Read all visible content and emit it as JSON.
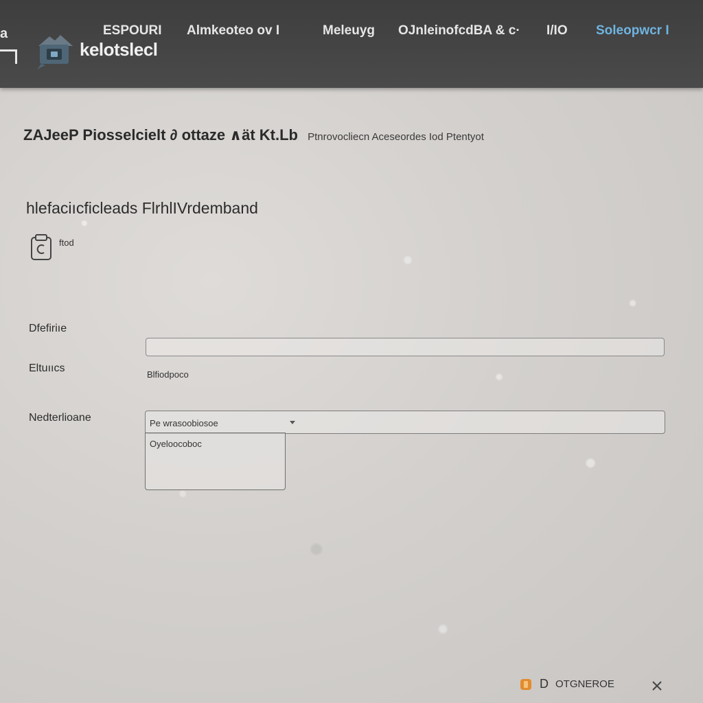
{
  "header": {
    "corner_label": "a",
    "brand_name": "kelotslecl",
    "nav": [
      {
        "label": "ESPOURI"
      },
      {
        "label": "Almkeoteo ov I"
      },
      {
        "label": "Meleuyg"
      },
      {
        "label": "OJnleinofcdBA & c·"
      },
      {
        "label": "I/IO"
      },
      {
        "label": "Soleopwcr I"
      }
    ],
    "accent_color": "#6fb4e0"
  },
  "headline": {
    "title": "ZAJeeP Piosselcielt ∂ ottaze ∧ät Kt.Lb",
    "subtitle": "Ptnrovocliecn Aceseordes Iod Ptentyot"
  },
  "section": {
    "title": "hlefaciıcficleads FlrhlIVrdemband",
    "document_label": "ftod"
  },
  "form": {
    "field1_label": "Dfefiriıe",
    "field1_value": "",
    "field2_label": "Eltuııcs",
    "field2_value": "Blfiodpoco",
    "field3_label": "Nedterlioane",
    "field3_selected": "Pe wrasoobiosoe",
    "field3_options": [
      "Oyeloocoboc"
    ]
  },
  "footer": {
    "letter": "D",
    "status_text": "OTGNEROE",
    "icon_color": "#e38b2f"
  }
}
